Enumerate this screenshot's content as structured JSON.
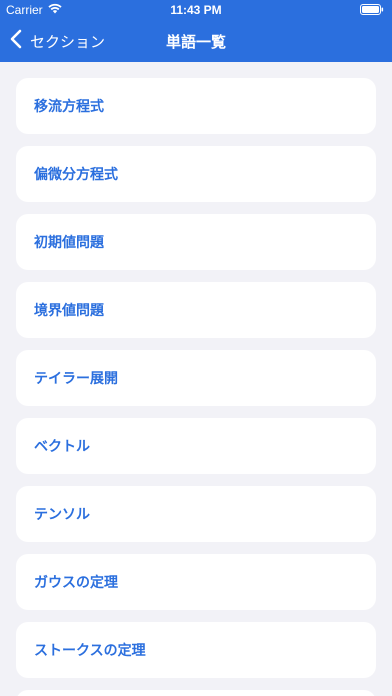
{
  "status": {
    "carrier": "Carrier",
    "time": "11:43 PM"
  },
  "nav": {
    "back_label": "セクション",
    "title": "単語一覧"
  },
  "items": [
    {
      "label": "移流方程式"
    },
    {
      "label": "偏微分方程式"
    },
    {
      "label": "初期値問題"
    },
    {
      "label": "境界値問題"
    },
    {
      "label": "テイラー展開"
    },
    {
      "label": "ベクトル"
    },
    {
      "label": "テンソル"
    },
    {
      "label": "ガウスの定理"
    },
    {
      "label": "ストークスの定理"
    }
  ],
  "colors": {
    "accent": "#2b6fde",
    "background": "#f2f2f7",
    "card": "#ffffff"
  }
}
